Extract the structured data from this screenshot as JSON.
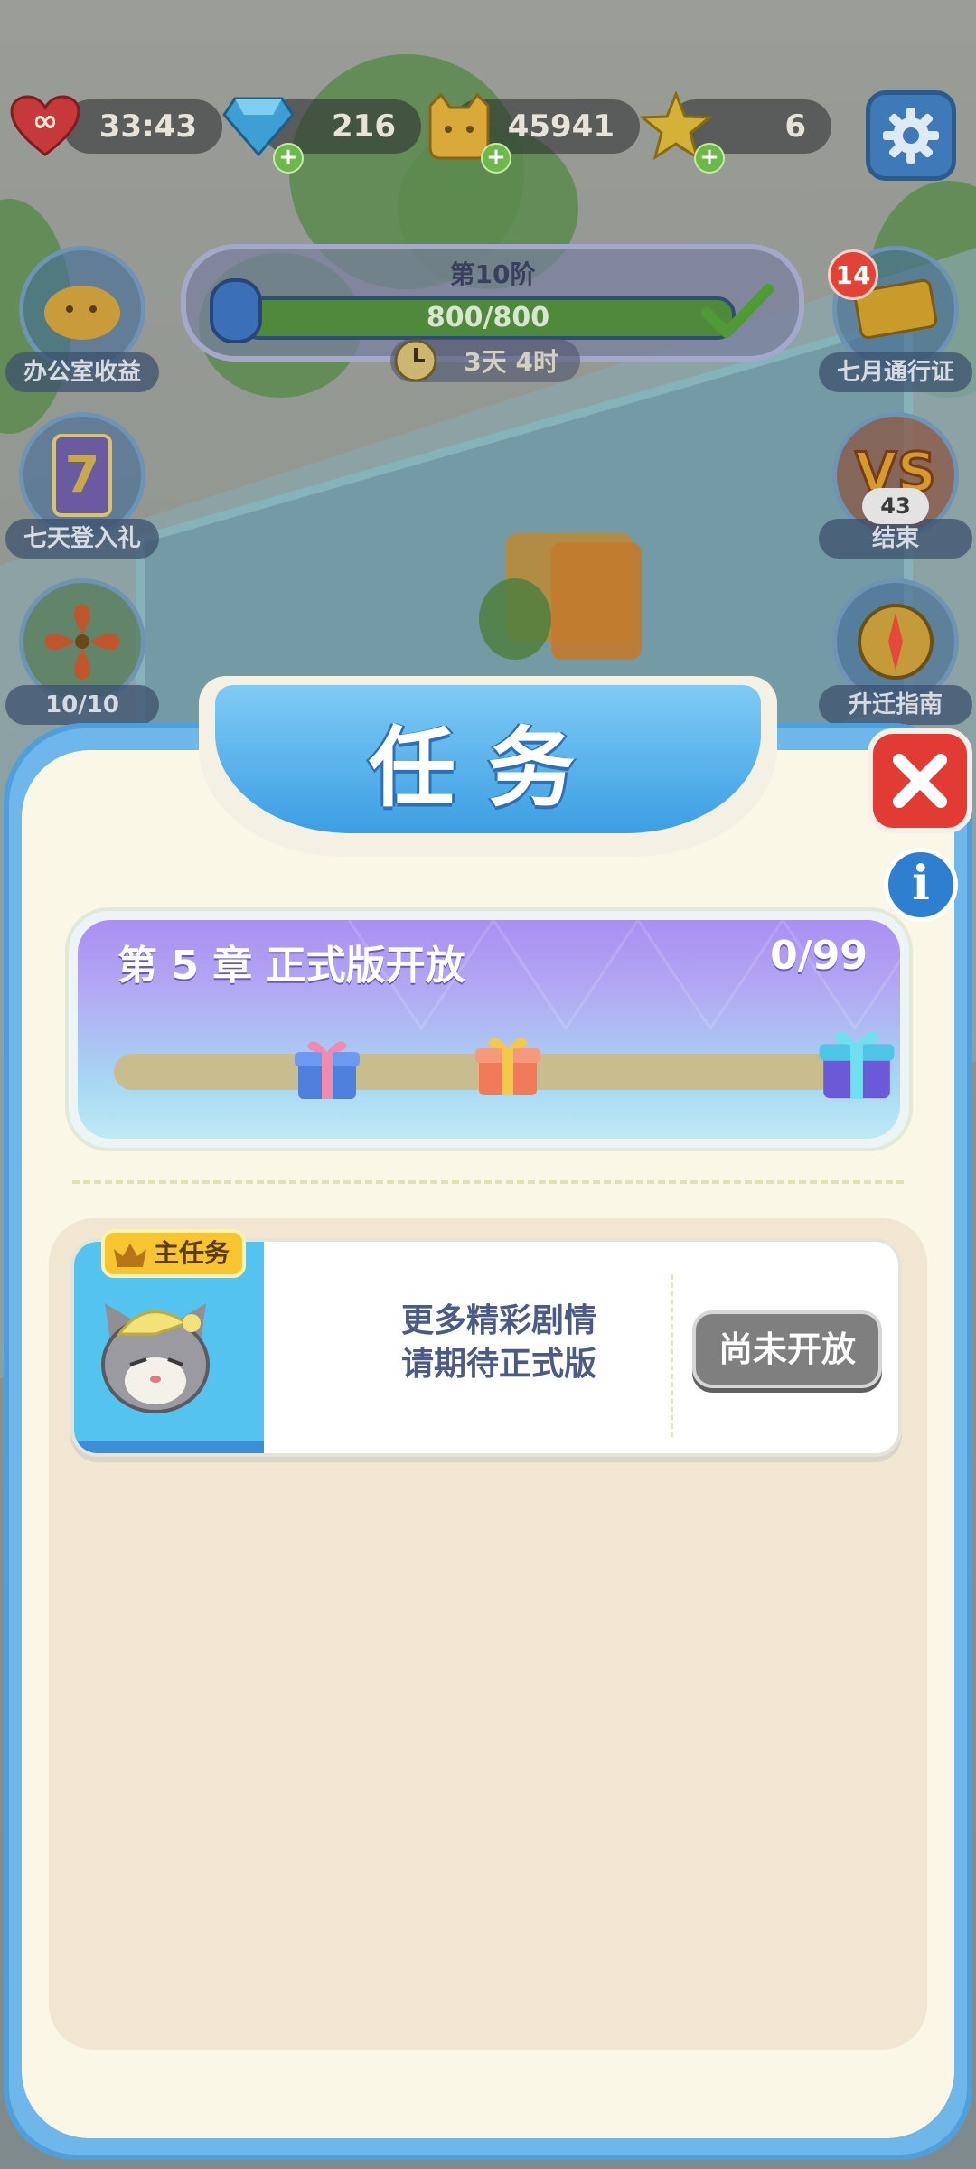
{
  "resources": {
    "lives_value": "33:43",
    "diamonds_value": "216",
    "coins_value": "45941",
    "stars_value": "6"
  },
  "stage": {
    "title": "第10阶",
    "progress_text": "800/800",
    "progress": 1.0,
    "timer": "3天 4时"
  },
  "side_left": [
    {
      "label": "办公室收益"
    },
    {
      "label": "七天登入礼"
    },
    {
      "label": "10/10"
    }
  ],
  "side_right": [
    {
      "label": "七月通行证",
      "badge": "14"
    },
    {
      "label": "结束",
      "sub": "43"
    },
    {
      "label": "升迁指南"
    }
  ],
  "panel": {
    "title": "任务",
    "chapter_title": "第 5 章 正式版开放",
    "chapter_count": "0/99",
    "chapter_progress": 0.0
  },
  "task": {
    "badge": "主任务",
    "text_line1": "更多精彩剧情",
    "text_line2": "请期待正式版",
    "button": "尚未开放"
  },
  "colors": {
    "panel_blue": "#6fb6ea",
    "close_red": "#e23b34",
    "info_blue": "#2f7fd0",
    "badge_yellow": "#f7c432",
    "chapter_purple": "#a98ff2"
  }
}
